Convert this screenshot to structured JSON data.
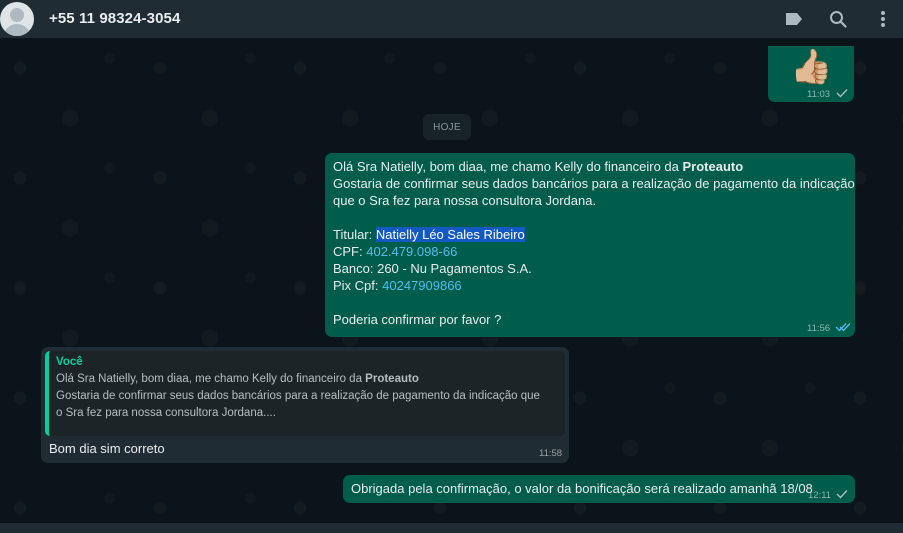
{
  "header": {
    "contact": "+55 11 98324-3054"
  },
  "messages": {
    "emoji": {
      "char": "👍🏼",
      "time": "11:03"
    },
    "date_chip": "HOJE",
    "m1": {
      "l1_pre": "Olá Sra Natielly, bom diaa, me chamo Kelly do financeiro da ",
      "l1_bold": "Proteauto",
      "l2": "Gostaria de confirmar seus dados bancários para a realização de pagamento da indicação",
      "l3": "que o Sra fez para nossa consultora Jordana.",
      "titular_label": "Titular: ",
      "titular_value": "Natielly Léo Sales Ribeiro",
      "cpf_label": "CPF: ",
      "cpf_value": "402.479.098-66",
      "banco": "Banco: 260 - Nu Pagamentos S.A.",
      "pix_label": "Pix Cpf: ",
      "pix_value": "40247909866",
      "closing": "Poderia confirmar por favor ?",
      "time": "11:56"
    },
    "m2": {
      "quote_author": "Você",
      "quote_l1_pre": "Olá Sra Natielly, bom diaa, me chamo Kelly do financeiro da ",
      "quote_l1_bold": "Proteauto",
      "quote_l2": "Gostaria de confirmar seus dados bancários para a realização de pagamento da indicação que",
      "quote_l3": "o Sra fez para nossa consultora Jordana....",
      "text": "Bom dia sim correto",
      "time": "11:58"
    },
    "m3": {
      "text": "Obrigada pela confirmação, o valor da bonificação será realizado amanhã 18/08",
      "time": "12:11"
    }
  },
  "colors": {
    "outgoing": "#005c4b",
    "incoming": "#202c33",
    "accent": "#06cf9c",
    "link": "#53bdeb"
  },
  "icons": [
    "avatar",
    "label-icon",
    "search-icon",
    "menu-icon",
    "check-icon",
    "double-check-icon"
  ]
}
